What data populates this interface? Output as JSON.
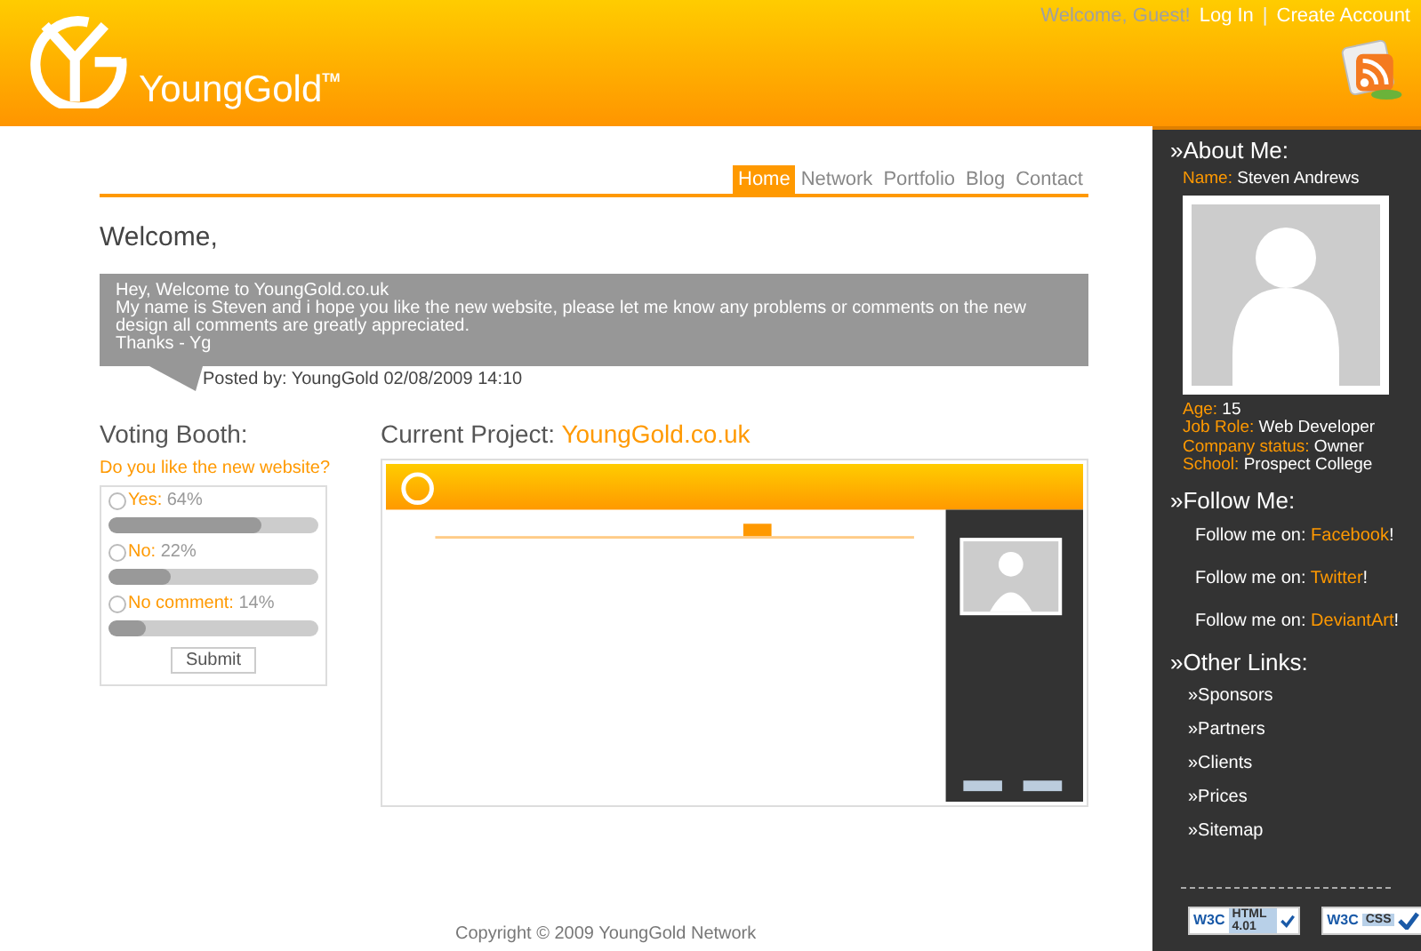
{
  "header": {
    "logo": "YoungGold",
    "trademark": "TM",
    "greeting": "Welcome, Guest!",
    "links": [
      {
        "label": "Log In"
      },
      {
        "label": "Create Account"
      }
    ],
    "separator": "|"
  },
  "nav": [
    {
      "label": "Home",
      "selected": true
    },
    {
      "label": "Network",
      "selected": false
    },
    {
      "label": "Portfolio",
      "selected": false
    },
    {
      "label": "Blog",
      "selected": false
    },
    {
      "label": "Contact",
      "selected": false
    }
  ],
  "welcome": {
    "heading": "Welcome,",
    "message": [
      "Hey, Welcome to YoungGold.co.uk",
      "My name is Steven and i hope you like the new website, please let me know any problems or comments on the new design all comments are greatly appreciated.",
      "Thanks - Yg"
    ],
    "posted": "Posted by: YoungGold 02/08/2009 14:10"
  },
  "voting": {
    "heading": "Voting Booth:",
    "question": "Do you like the new website?",
    "options": [
      {
        "label": "Yes:",
        "percent": "64%",
        "checked": false,
        "level": 0.73
      },
      {
        "label": "No:",
        "percent": "22%",
        "checked": false,
        "level": 0.3
      },
      {
        "label": "No comment:",
        "percent": "14%",
        "checked": false,
        "level": 0.18
      }
    ],
    "submit": "Submit"
  },
  "project": {
    "heading": "Current Project:",
    "link": "YoungGold.co.uk"
  },
  "footer": "Copyright © 2009 YoungGold Network",
  "sidebar": {
    "about": {
      "heading": "»About Me:",
      "name": {
        "label": "Name:",
        "value": "Steven Andrews"
      },
      "details": [
        {
          "label": "Age:",
          "value": "15"
        },
        {
          "label": "Job Role:",
          "value": "Web Developer"
        },
        {
          "label": "Company status:",
          "value": "Owner"
        },
        {
          "label": "School:",
          "value": "Prospect College"
        }
      ]
    },
    "follow": {
      "heading": "»Follow Me:",
      "items": [
        {
          "prefix": "Follow me on:",
          "link": "Facebook",
          "suffix": "!"
        },
        {
          "prefix": "Follow me on:",
          "link": "Twitter",
          "suffix": "!"
        },
        {
          "prefix": "Follow me on:",
          "link": "DeviantArt",
          "suffix": "!"
        }
      ]
    },
    "other": {
      "heading": "»Other Links:",
      "links": [
        "»Sponsors",
        "»Partners",
        "»Clients",
        "»Prices",
        "»Sitemap"
      ]
    },
    "badges": [
      {
        "mark": "W3C",
        "text": "HTML 4.01"
      },
      {
        "mark": "W3C",
        "text": "CSS"
      }
    ]
  }
}
